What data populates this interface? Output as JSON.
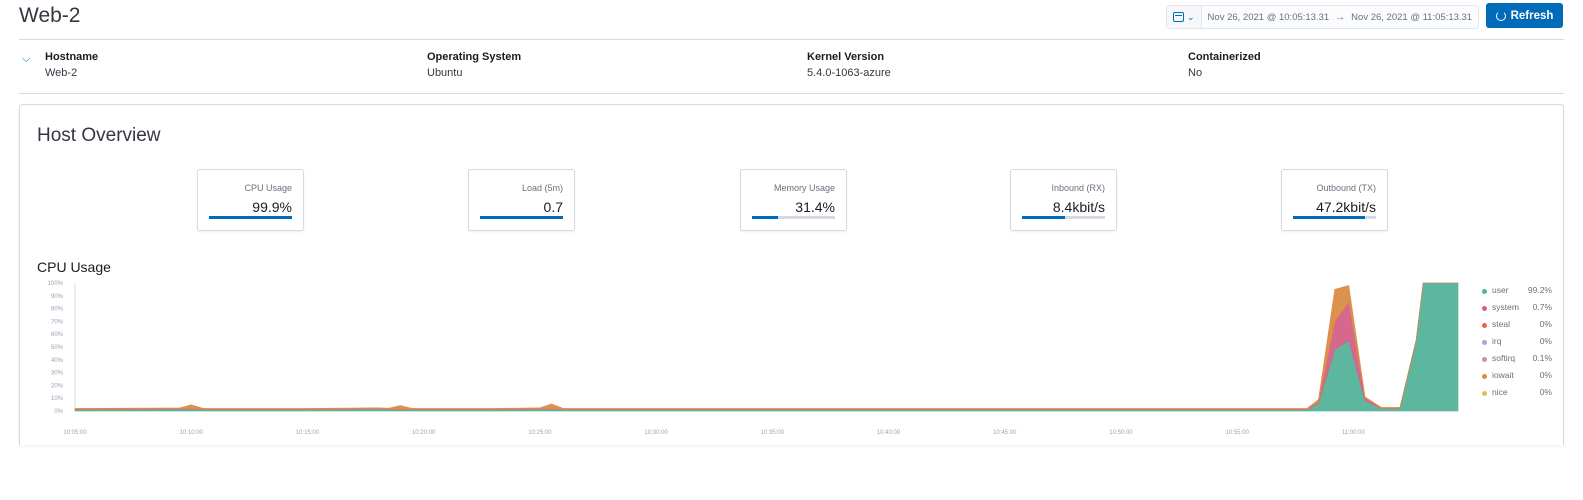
{
  "header": {
    "title": "Web-2",
    "date_start": "Nov 26, 2021 @ 10:05:13.31",
    "date_arrow": "→",
    "date_end": "Nov 26, 2021 @ 11:05:13.31",
    "refresh_label": "Refresh"
  },
  "meta": [
    {
      "label": "Hostname",
      "value": "Web-2"
    },
    {
      "label": "Operating System",
      "value": "Ubuntu"
    },
    {
      "label": "Kernel Version",
      "value": "5.4.0-1063-azure"
    },
    {
      "label": "Containerized",
      "value": "No"
    }
  ],
  "overview": {
    "title": "Host Overview",
    "kpis": [
      {
        "label": "CPU Usage",
        "value": "99.9%",
        "progress": 1.0
      },
      {
        "label": "Load (5m)",
        "value": "0.7",
        "progress": 1.0
      },
      {
        "label": "Memory Usage",
        "value": "31.4%",
        "progress": 0.314
      },
      {
        "label": "Inbound (RX)",
        "value": "8.4kbit/s",
        "progress": 0.52
      },
      {
        "label": "Outbound (TX)",
        "value": "47.2kbit/s",
        "progress": 0.87
      }
    ]
  },
  "cpu_chart": {
    "title": "CPU Usage",
    "legend": [
      {
        "name": "user",
        "value": "99.2%",
        "color": "#54b399"
      },
      {
        "name": "system",
        "value": "0.7%",
        "color": "#d36086"
      },
      {
        "name": "steal",
        "value": "0%",
        "color": "#e7664c"
      },
      {
        "name": "irq",
        "value": "0%",
        "color": "#b9a0d4"
      },
      {
        "name": "softirq",
        "value": "0.1%",
        "color": "#ca8eae"
      },
      {
        "name": "iowait",
        "value": "0%",
        "color": "#da8b45"
      },
      {
        "name": "nice",
        "value": "0%",
        "color": "#d6bf57"
      }
    ]
  },
  "chart_data": {
    "type": "area",
    "title": "CPU Usage",
    "stacked": true,
    "y_ticks": [
      "0%",
      "10%",
      "20%",
      "30%",
      "40%",
      "50%",
      "60%",
      "70%",
      "80%",
      "90%",
      "100%"
    ],
    "x_ticks": [
      "10:05:00",
      "10:10:00",
      "10:15:00",
      "10:20:00",
      "10:25:00",
      "10:30:00",
      "10:35:00",
      "10:40:00",
      "10:45:00",
      "10:50:00",
      "10:55:00",
      "11:00:00"
    ],
    "ylim": [
      0,
      100
    ],
    "x_range_minutes": [
      0,
      59.5
    ],
    "series": [
      {
        "name": "user",
        "color": "#54b399",
        "points": [
          [
            0,
            1
          ],
          [
            5,
            1.5
          ],
          [
            5.6,
            1
          ],
          [
            10,
            1
          ],
          [
            13,
            1.5
          ],
          [
            14,
            1
          ],
          [
            18,
            1
          ],
          [
            20,
            1.5
          ],
          [
            21,
            1
          ],
          [
            53,
            1
          ],
          [
            53.5,
            6
          ],
          [
            54.2,
            48
          ],
          [
            54.8,
            55
          ],
          [
            55.5,
            8
          ],
          [
            56.2,
            2
          ],
          [
            57,
            2
          ],
          [
            57.7,
            55
          ],
          [
            58,
            100
          ],
          [
            59.5,
            100
          ]
        ]
      },
      {
        "name": "system",
        "color": "#d36086",
        "points": [
          [
            0,
            0.3
          ],
          [
            53,
            0.3
          ],
          [
            53.5,
            1
          ],
          [
            54.2,
            22
          ],
          [
            54.8,
            30
          ],
          [
            55.5,
            2
          ],
          [
            56.2,
            0.3
          ],
          [
            57.7,
            0.3
          ],
          [
            58,
            0
          ],
          [
            59.5,
            0
          ]
        ]
      },
      {
        "name": "iowait",
        "color": "#da8b45",
        "points": [
          [
            0,
            0.7
          ],
          [
            4.5,
            0.7
          ],
          [
            5,
            3
          ],
          [
            5.5,
            0.7
          ],
          [
            13.5,
            0.7
          ],
          [
            14,
            3
          ],
          [
            14.5,
            0.7
          ],
          [
            20,
            0.7
          ],
          [
            20.5,
            4
          ],
          [
            21,
            0.7
          ],
          [
            53,
            0.7
          ],
          [
            53.5,
            2
          ],
          [
            54.2,
            25
          ],
          [
            54.8,
            13
          ],
          [
            55.5,
            1
          ],
          [
            56.2,
            0.5
          ],
          [
            57.7,
            0.5
          ],
          [
            58,
            0
          ],
          [
            59.5,
            0
          ]
        ]
      }
    ]
  }
}
